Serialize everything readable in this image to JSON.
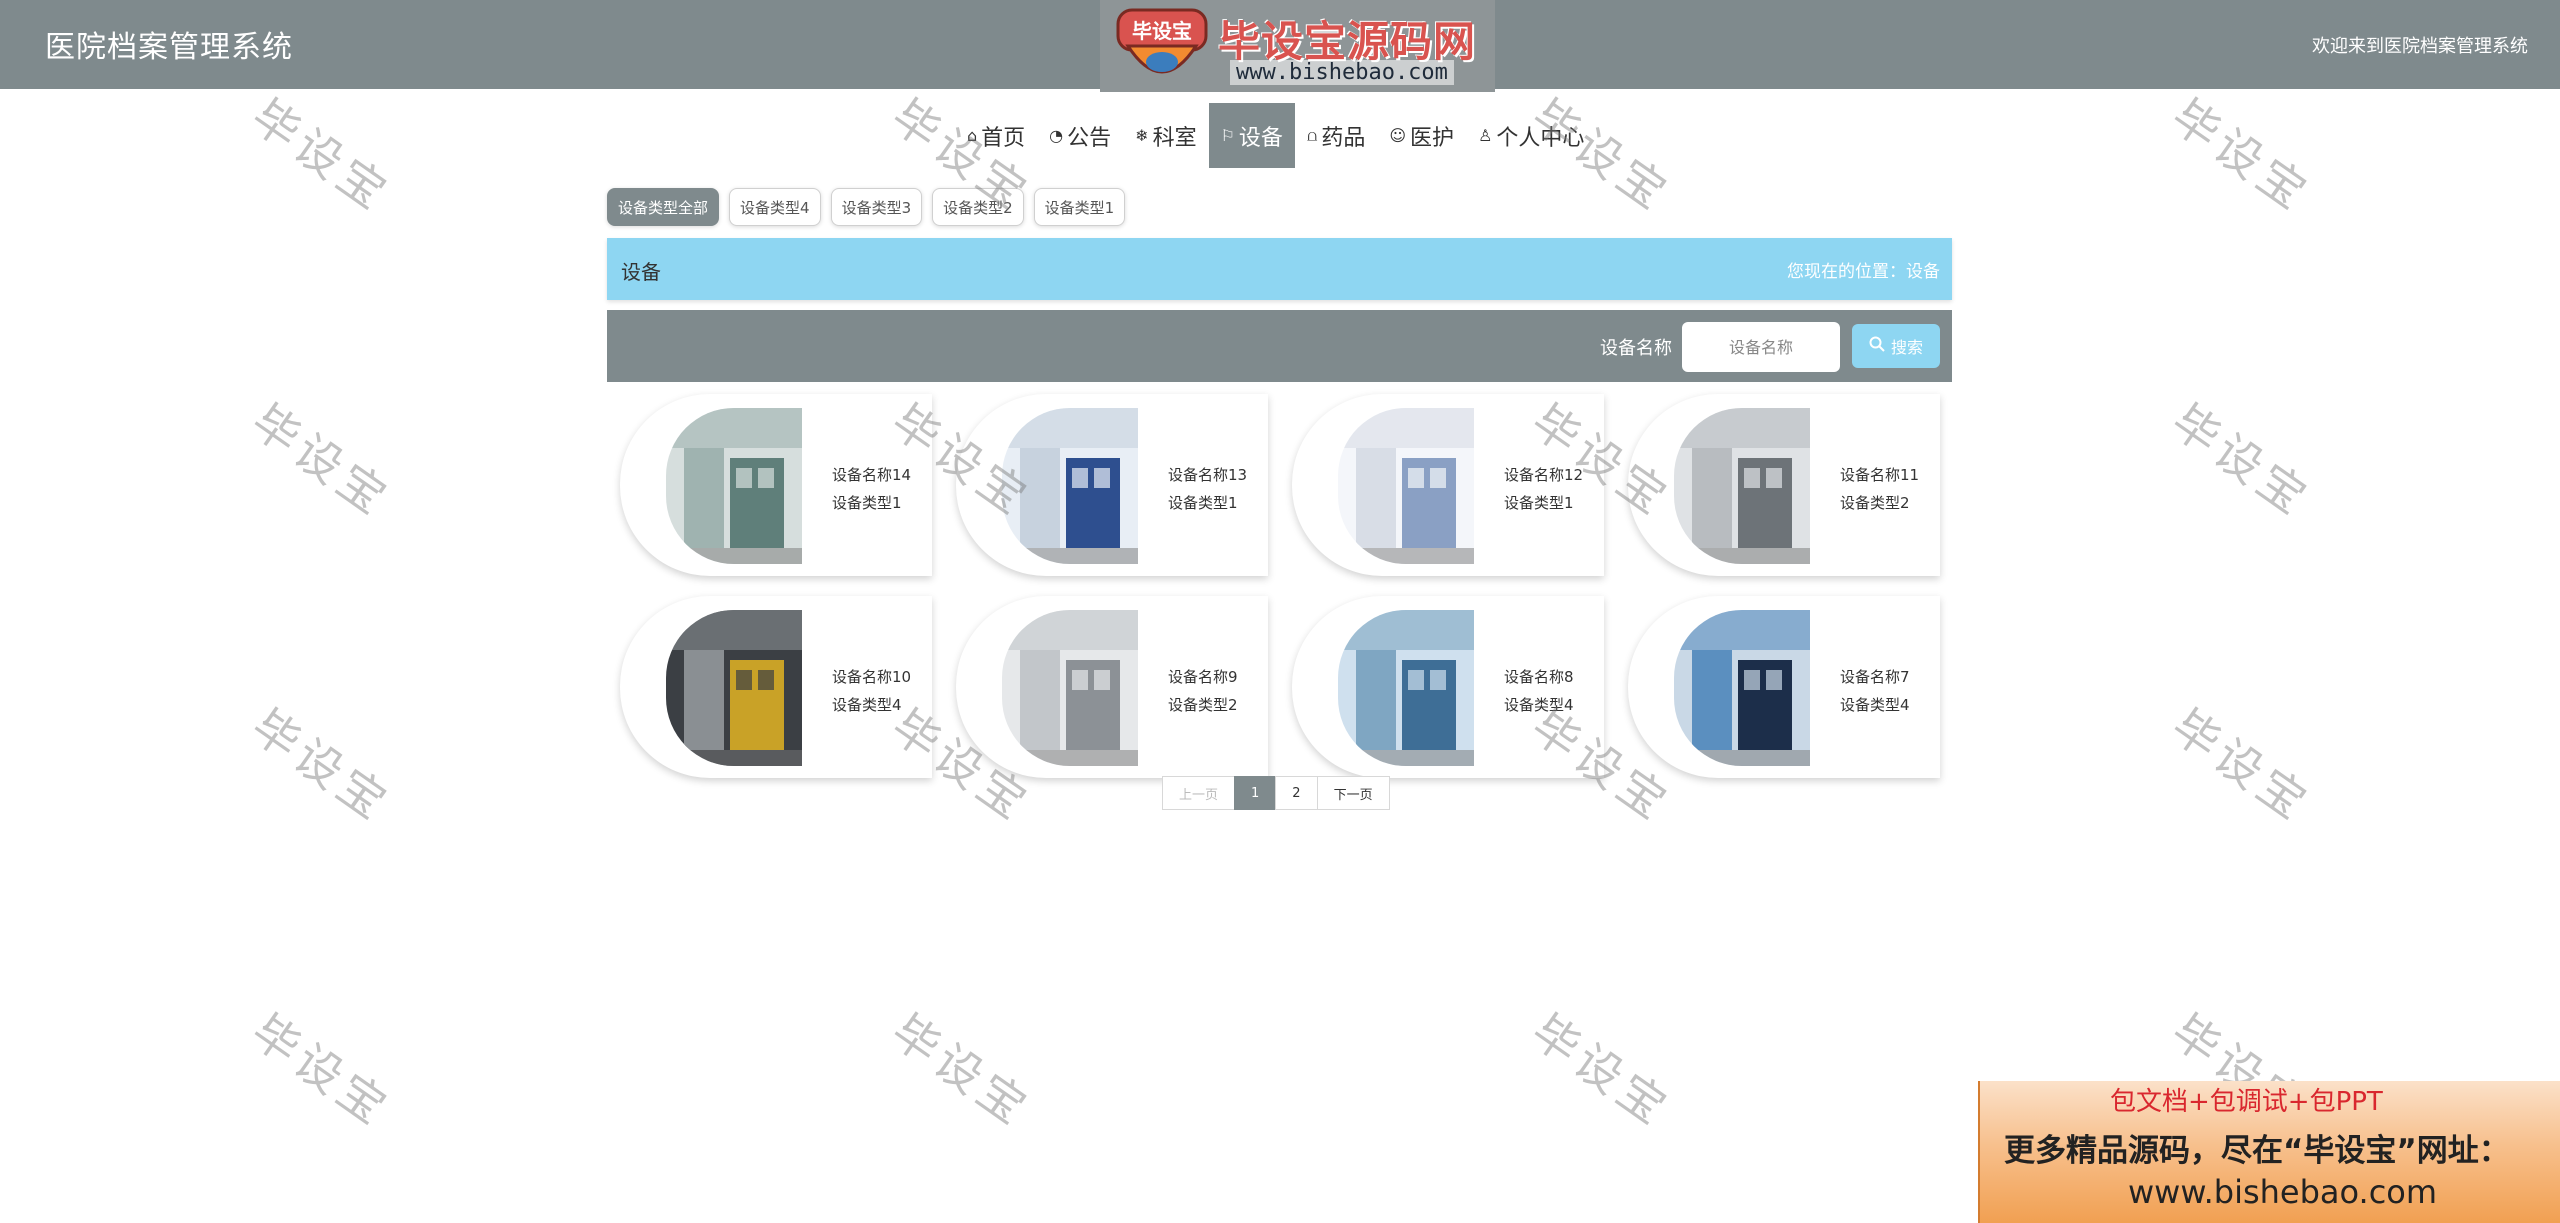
{
  "header": {
    "site_title": "医院档案管理系统",
    "welcome": "欢迎来到医院档案管理系统"
  },
  "logo": {
    "emblem_text": "毕设宝",
    "brand": "毕设宝源码网",
    "url": "www.bishebao.com"
  },
  "nav": [
    {
      "label": "首页",
      "icon": "home-icon",
      "glyph": "⌂",
      "active": false
    },
    {
      "label": "公告",
      "icon": "dashboard-icon",
      "glyph": "◔",
      "active": false
    },
    {
      "label": "科室",
      "icon": "snowflake-icon",
      "glyph": "❄",
      "active": false
    },
    {
      "label": "设备",
      "icon": "flag-icon",
      "glyph": "⚐",
      "active": true
    },
    {
      "label": "药品",
      "icon": "book-icon",
      "glyph": "⩍",
      "active": false
    },
    {
      "label": "医护",
      "icon": "smile-icon",
      "glyph": "☺",
      "active": false
    },
    {
      "label": "个人中心",
      "icon": "user-icon",
      "glyph": "♙",
      "active": false
    }
  ],
  "filters": [
    {
      "label": "设备类型全部",
      "active": true
    },
    {
      "label": "设备类型4",
      "active": false
    },
    {
      "label": "设备类型3",
      "active": false
    },
    {
      "label": "设备类型2",
      "active": false
    },
    {
      "label": "设备类型1",
      "active": false
    }
  ],
  "section": {
    "title": "设备",
    "breadcrumb": "您现在的位置：设备"
  },
  "search": {
    "label": "设备名称",
    "placeholder": "设备名称",
    "button_label": "搜索",
    "button_icon": "search-icon"
  },
  "items": [
    {
      "name": "设备名称14",
      "type": "设备类型1"
    },
    {
      "name": "设备名称13",
      "type": "设备类型1"
    },
    {
      "name": "设备名称12",
      "type": "设备类型1"
    },
    {
      "name": "设备名称11",
      "type": "设备类型2"
    },
    {
      "name": "设备名称10",
      "type": "设备类型4"
    },
    {
      "name": "设备名称9",
      "type": "设备类型2"
    },
    {
      "name": "设备名称8",
      "type": "设备类型4"
    },
    {
      "name": "设备名称7",
      "type": "设备类型4"
    }
  ],
  "pagination": {
    "prev": "上一页",
    "pages": [
      "1",
      "2"
    ],
    "current": "1",
    "next": "下一页"
  },
  "watermark": "毕设宝",
  "promo": {
    "line1": "包文档+包调试+包PPT",
    "line2": "更多精品源码，尽在“毕设宝”网址：",
    "line3": "www.bishebao.com"
  },
  "colors": {
    "header_bg": "#7f8a8d",
    "accent_blue": "#8ed6f2",
    "brand_red": "#d9534f"
  }
}
